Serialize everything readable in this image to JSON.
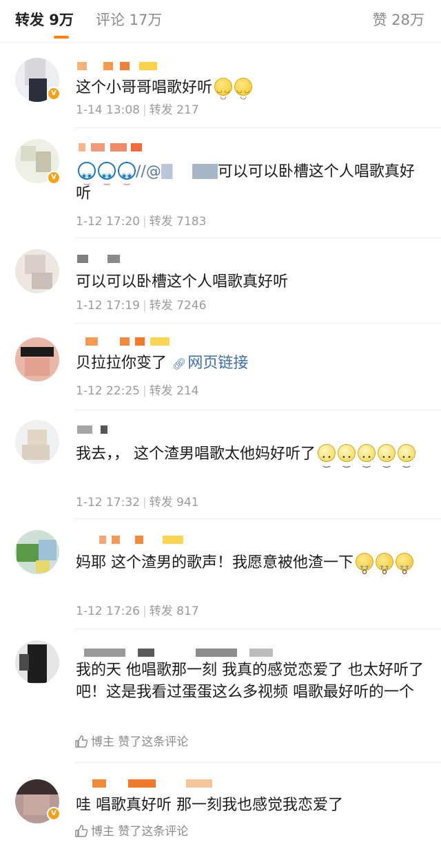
{
  "tabs": {
    "repost": "转发 9万",
    "comment": "评论 17万",
    "like": "赞 28万"
  },
  "colors": {
    "accent": "#ff8200",
    "link": "#3d6ea8",
    "meta": "#9b9b9b"
  },
  "items": [
    {
      "text": "这个小哥哥唱歌好听",
      "emoji": [
        "smile-emoji",
        "smile-emoji"
      ],
      "time": "1-14 13:08",
      "repost": "转发 217"
    },
    {
      "mention": "//@",
      "text": "可以可以卧槽这个人唱歌真好听",
      "emoji": [
        "face-emoji",
        "face-emoji",
        "face-emoji"
      ],
      "time": "1-12 17:20",
      "repost": "转发 7183"
    },
    {
      "text": "可以可以卧槽这个人唱歌真好听",
      "time": "1-12 17:19",
      "repost": "转发 7246"
    },
    {
      "text": "贝拉拉你变了",
      "link": "网页链接",
      "link_icon": "link-icon",
      "time": "1-12 22:25",
      "repost": "转发 214"
    },
    {
      "text": "我去，，  这个渣男唱歌太他妈好听了",
      "emoji": [
        "sweat-emoji",
        "sweat-emoji",
        "sweat-emoji",
        "sweat-emoji",
        "sweat-emoji"
      ],
      "time": "1-12 17:32",
      "repost": "转发 941"
    },
    {
      "text": "妈耶 这个渣男的歌声！我愿意被他渣一下",
      "emoji": [
        "cry-emoji",
        "cry-emoji",
        "cry-emoji"
      ],
      "time": "1-12 17:26",
      "repost": "转发 817"
    },
    {
      "text": "我的天 他唱歌那一刻 我真的感觉恋爱了 也太好听了吧！这是我看过蛋蛋这么多视频 唱歌最好听的一个",
      "blogger_label": "博主",
      "blogger_action": "赞了这条评论",
      "thumb_icon": "thumbs-up-icon"
    },
    {
      "text": "哇 唱歌真好听 那一刻我也感觉我恋爱了",
      "blogger_label": "博主",
      "blogger_action": "赞了这条评论",
      "thumb_icon": "thumbs-up-icon"
    }
  ]
}
